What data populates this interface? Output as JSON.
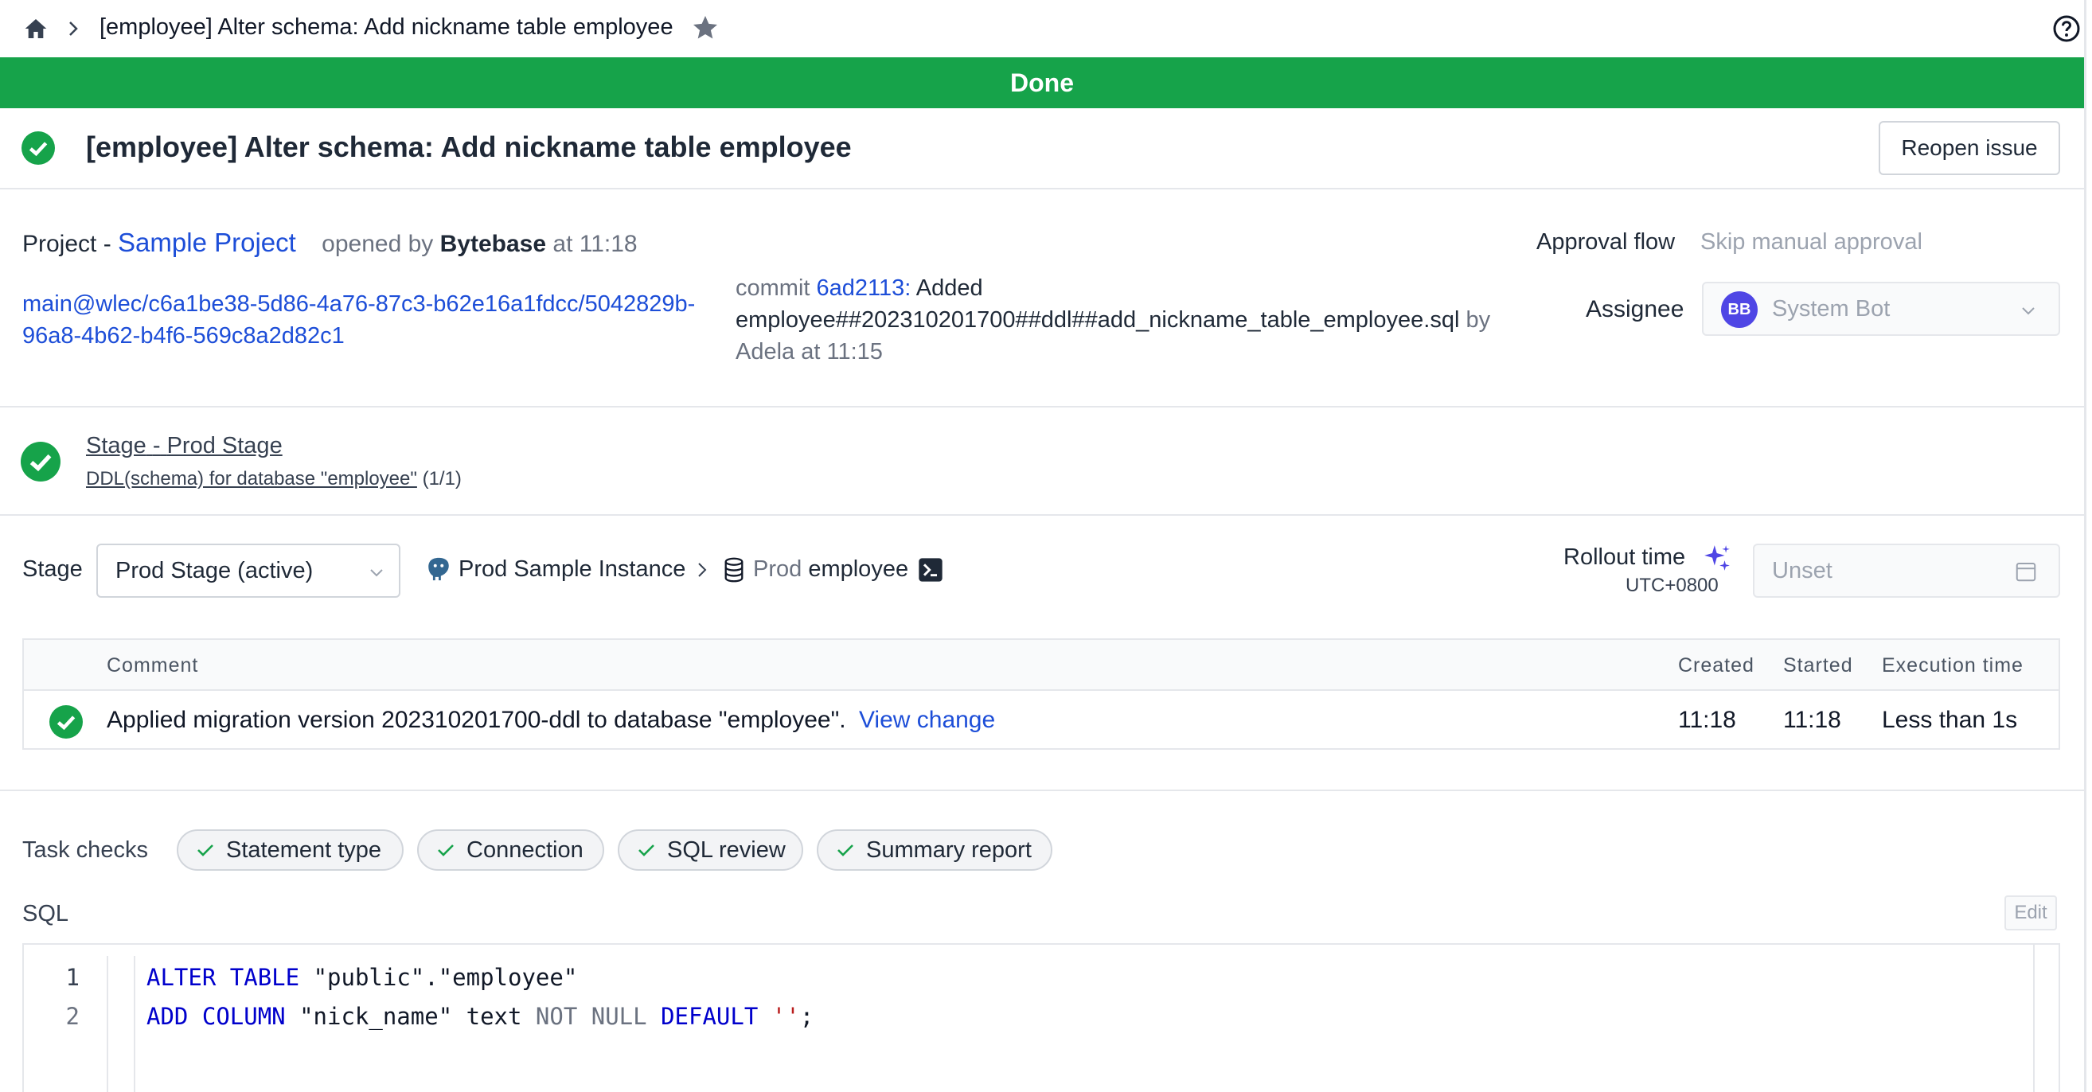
{
  "breadcrumb": {
    "title": "[employee] Alter schema: Add nickname table employee"
  },
  "banner": {
    "status": "Done"
  },
  "issue": {
    "title": "[employee] Alter schema: Add nickname table employee",
    "reopen_label": "Reopen issue"
  },
  "info": {
    "project_label": "Project -",
    "project_name": "Sample Project",
    "opened_by_prefix": "opened by",
    "creator": "Bytebase",
    "opened_at": "at 11:18",
    "branch_line1": "main@wlec/c6a1be38-5d86-4a76-87c3-b62e16a1fdcc/5042829b-",
    "branch_line2": "96a8-4b62-b4f6-569c8a2d82c1",
    "commit_label": "commit",
    "commit_hash": "6ad2113",
    "commit_colon": ":",
    "commit_msg_1": "Added",
    "commit_msg_2": "employee##202310201700##ddl##add_nickname_table_employee.sql",
    "commit_by": "by",
    "commit_author_time": "Adela at 11:15",
    "approval_flow_label": "Approval flow",
    "approval_flow_value": "Skip manual approval",
    "assignee_label": "Assignee",
    "assignee_initials": "BB",
    "assignee_name": "System Bot"
  },
  "stage_summary": {
    "stage_word": "Stage",
    "dash": "-",
    "stage_name": "Prod Stage",
    "task_link": "DDL(schema) for database \"employee\"",
    "task_count": "(1/1)"
  },
  "stage_bar": {
    "stage_label": "Stage",
    "stage_select": "Prod Stage (active)",
    "instance_name": "Prod Sample Instance",
    "env_name": "Prod",
    "database_name": "employee",
    "rollout_label": "Rollout time",
    "timezone": "UTC+0800",
    "rollout_placeholder": "Unset"
  },
  "task_table": {
    "headers": {
      "comment": "Comment",
      "created": "Created",
      "started": "Started",
      "execution": "Execution time"
    },
    "rows": [
      {
        "comment": "Applied migration version 202310201700-ddl to database \"employee\".",
        "link": "View change",
        "created": "11:18",
        "started": "11:18",
        "execution": "Less than 1s"
      }
    ]
  },
  "task_checks": {
    "label": "Task checks",
    "items": [
      "Statement type",
      "Connection",
      "SQL review",
      "Summary report"
    ]
  },
  "sql": {
    "label": "SQL",
    "edit_label": "Edit",
    "line_numbers": [
      "1",
      "2"
    ],
    "line1": {
      "kw_alter": "ALTER",
      "kw_table": "TABLE",
      "rest": "\"public\".\"employee\""
    },
    "line2": {
      "kw_add": "ADD",
      "kw_column": "COLUMN",
      "col": "\"nick_name\" text",
      "not_null": "NOT NULL",
      "kw_default": "DEFAULT",
      "str": "''",
      "semi": ";"
    }
  },
  "colors": {
    "success": "#16a34a",
    "link": "#1d4ed8",
    "avatar": "#4f46e5",
    "accent_sparkle": "#4f46e5"
  },
  "icons": [
    "home-icon",
    "chevron-right-icon",
    "star-icon",
    "help-icon",
    "check-circle-icon",
    "chevron-down-icon",
    "postgres-icon",
    "database-icon",
    "terminal-icon",
    "sparkle-icon",
    "calendar-icon",
    "check-icon"
  ]
}
